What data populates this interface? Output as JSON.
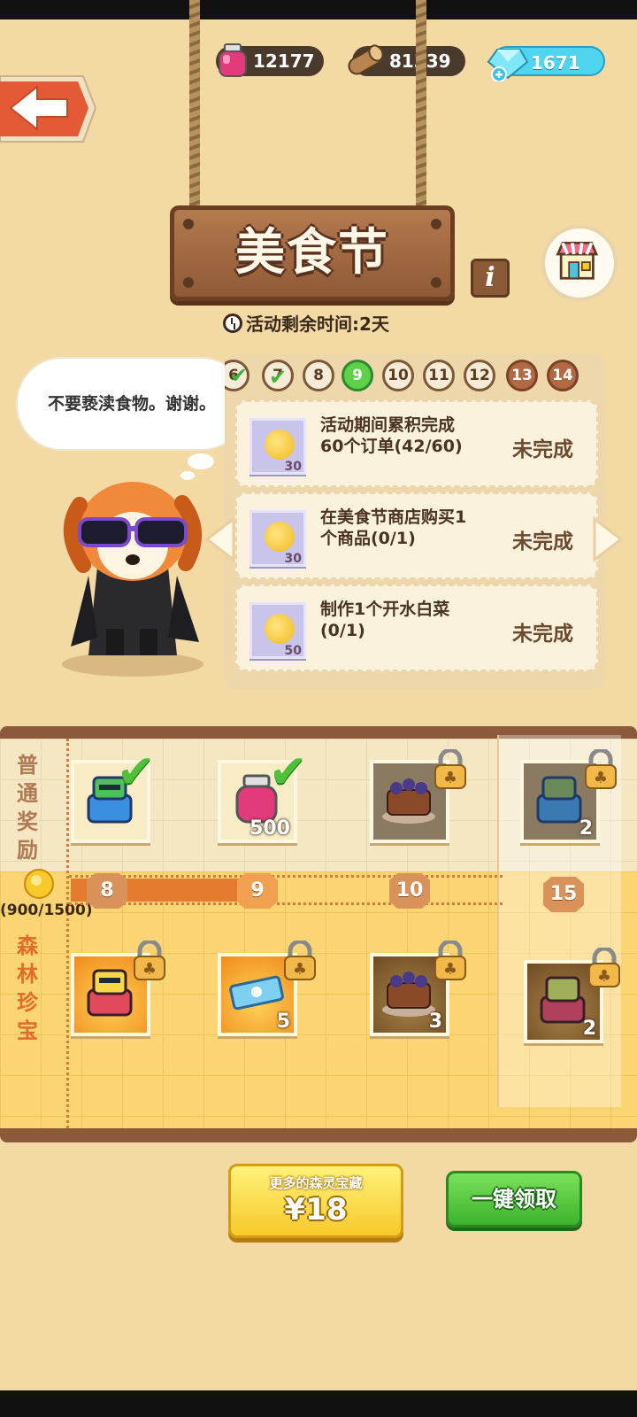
{
  "resources": {
    "ink": "12177",
    "wood": "81339",
    "gems": "1671"
  },
  "event": {
    "title": "美食节",
    "timer": "活动剩余时间:2天",
    "info_label": "i"
  },
  "character": {
    "speech": "不要亵渎食物。谢谢。"
  },
  "days": [
    {
      "label": "6",
      "state": "done"
    },
    {
      "label": "7",
      "state": "done"
    },
    {
      "label": "8",
      "state": "normal"
    },
    {
      "label": "9",
      "state": "active"
    },
    {
      "label": "10",
      "state": "normal"
    },
    {
      "label": "11",
      "state": "normal"
    },
    {
      "label": "12",
      "state": "normal"
    },
    {
      "label": "13",
      "state": "dark"
    },
    {
      "label": "14",
      "state": "dark"
    }
  ],
  "tasks": [
    {
      "reward": "30",
      "text": "活动期间累积完成60个订单(42/60)",
      "status": "未完成"
    },
    {
      "reward": "30",
      "text": "在美食节商店购买1个商品(0/1)",
      "status": "未完成"
    },
    {
      "reward": "50",
      "text": "制作1个开水白菜(0/1)",
      "status": "未完成"
    }
  ],
  "rewards": {
    "normal_label": "普通奖励",
    "forest_label": "森林珍宝",
    "progress": "(900/1500)",
    "progress_fraction": 0.6,
    "tiers": [
      "8",
      "9",
      "10",
      "15"
    ],
    "normal_items": [
      {
        "name": "robot-toy",
        "qty": "",
        "claimed": true,
        "locked": false
      },
      {
        "name": "ink-jar",
        "qty": "500",
        "claimed": true,
        "locked": false
      },
      {
        "name": "cake-plate",
        "qty": "",
        "claimed": false,
        "locked": true
      },
      {
        "name": "robot-toy",
        "qty": "2",
        "claimed": false,
        "locked": true
      }
    ],
    "forest_items": [
      {
        "name": "robot-toy-red",
        "qty": "",
        "locked": true
      },
      {
        "name": "ticket",
        "qty": "5",
        "locked": true
      },
      {
        "name": "cake-plate",
        "qty": "3",
        "locked": true
      },
      {
        "name": "robot-toy-red",
        "qty": "2",
        "locked": true
      }
    ]
  },
  "buttons": {
    "buy_sub": "更多的森灵宝藏",
    "buy_price": "¥18",
    "claim_all": "一键领取"
  },
  "colors": {
    "background": "#f3d9a4",
    "accent_green": "#4fc03a",
    "progress_orange": "#e47a2e",
    "gem_blue": "#4fd5ef"
  }
}
